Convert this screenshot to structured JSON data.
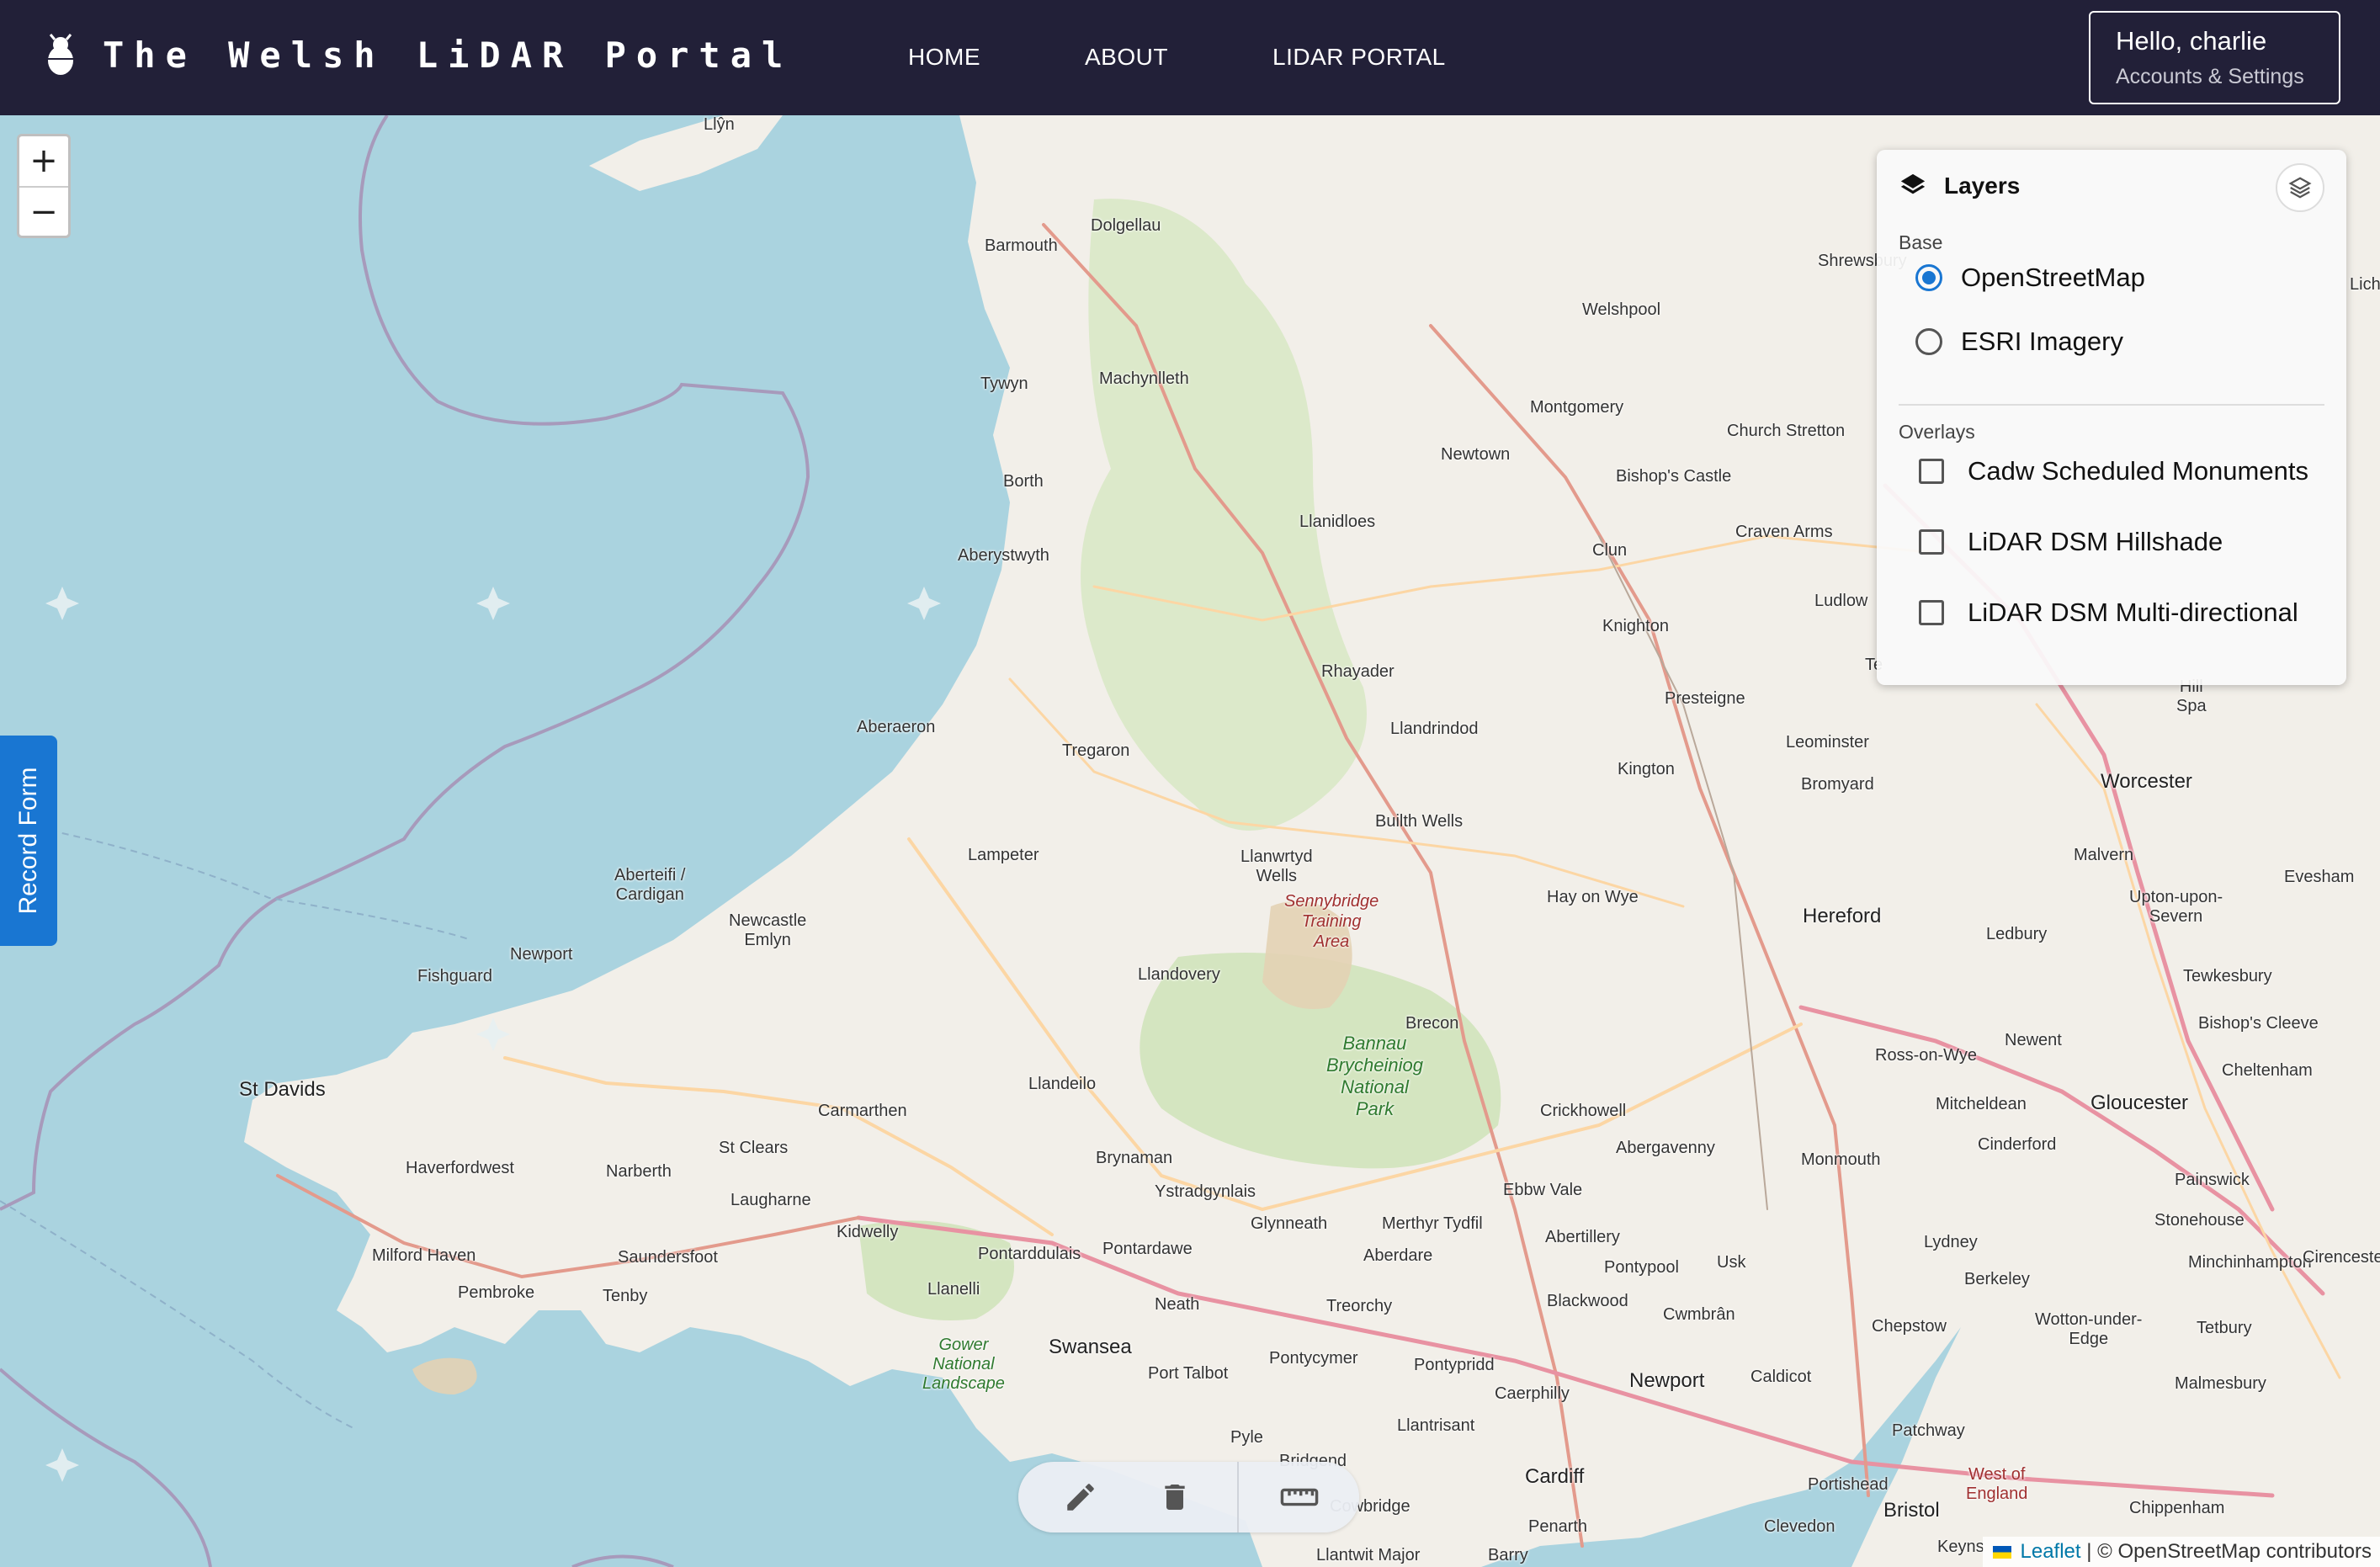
{
  "header": {
    "title": "The Welsh LiDAR Portal",
    "logo_icon": "bug-icon",
    "nav": [
      {
        "label": "HOME"
      },
      {
        "label": "ABOUT"
      },
      {
        "label": "LIDAR PORTAL"
      }
    ],
    "user": {
      "greeting": "Hello, charlie",
      "subtitle": "Accounts & Settings"
    }
  },
  "map": {
    "zoom_in": "+",
    "zoom_out": "−",
    "places": {
      "lyn": "Llŷn",
      "barmouth": "Barmouth",
      "dolgellau": "Dolgellau",
      "shrewsbury": "Shrewsbury",
      "welshpool": "Welshpool",
      "tywyn": "Tywyn",
      "machynlleth": "Machynlleth",
      "montgomery": "Montgomery",
      "church_stretton": "Church Stretton",
      "newtown": "Newtown",
      "bishops_castle": "Bishop's Castle",
      "borth": "Borth",
      "llanidloes": "Llanidloes",
      "craven_arms": "Craven Arms",
      "clun": "Clun",
      "aberystwyth": "Aberystwyth",
      "ludlow": "Ludlow",
      "knighton": "Knighton",
      "rhayader": "Rhayader",
      "presteigne": "Presteigne",
      "aberaeron": "Aberaeron",
      "llandrindod": "Llandrindod",
      "tregaron": "Tregaron",
      "leominster": "Leominster",
      "kington": "Kington",
      "builth_wells": "Builth Wells",
      "bromyard": "Bromyard",
      "worcester": "Worcester",
      "lampeter": "Lampeter",
      "llanwrtyd": "Llanwrtyd\nWells",
      "aberteifi": "Aberteifi /\nCardigan",
      "newcastle_emlyn": "Newcastle\nEmlyn",
      "hay_on_wye": "Hay on Wye",
      "hereford": "Hereford",
      "malvern": "Malvern",
      "evesham": "Evesham",
      "upton": "Upton-upon-\nSevern",
      "fishguard": "Fishguard",
      "newport_pemb": "Newport",
      "ledbury": "Ledbury",
      "llandovery": "Llandovery",
      "tewkesbury": "Tewkesbury",
      "brecon": "Brecon",
      "newent": "Newent",
      "bishops_cleeve": "Bishop's Cleeve",
      "ross_on_wye": "Ross-on-Wye",
      "st_davids": "St Davids",
      "llandeilo": "Llandeilo",
      "cheltenham": "Cheltenham",
      "carmarthen": "Carmarthen",
      "crickhowell": "Crickhowell",
      "mitcheldean": "Mitcheldean",
      "gloucester": "Gloucester",
      "haverfordwest": "Haverfordwest",
      "narberth": "Narberth",
      "st_clears": "St Clears",
      "brynaman": "Brynaman",
      "abergavenny": "Abergavenny",
      "cinderford": "Cinderford",
      "monmouth": "Monmouth",
      "painswick": "Painswick",
      "laugharne": "Laugharne",
      "ystradgynlais": "Ystradgynlais",
      "ebbw_vale": "Ebbw Vale",
      "milford_haven": "Milford Haven",
      "saundersfoot": "Saundersfoot",
      "kidwelly": "Kidwelly",
      "glynneath": "Glynneath",
      "merthyr": "Merthyr Tydfil",
      "abertillery": "Abertillery",
      "stonehouse": "Stonehouse",
      "pontardulais": "Pontarddulais",
      "pontardawe": "Pontardawe",
      "aberdare": "Aberdare",
      "pontypool": "Pontypool",
      "usk": "Usk",
      "lydney": "Lydney",
      "minchinhampton": "Minchinhampton",
      "pembroke": "Pembroke",
      "tenby": "Tenby",
      "llanelli": "Llanelli",
      "blackwood": "Blackwood",
      "berkeley": "Berkeley",
      "treorchy": "Treorchy",
      "cwmbran": "Cwmbrân",
      "neath": "Neath",
      "chepstow": "Chepstow",
      "wotton": "Wotton-under-\nEdge",
      "tetbury": "Tetbury",
      "swansea": "Swansea",
      "pontycymer": "Pontycymer",
      "port_talbot": "Port Talbot",
      "pontypridd": "Pontypridd",
      "caerphilly": "Caerphilly",
      "caldicot": "Caldicot",
      "newport": "Newport",
      "malmesbury": "Malmesbury",
      "llantrisant": "Llantrisant",
      "patchway": "Patchway",
      "pyle": "Pyle",
      "bridgend": "Bridgend",
      "cardiff": "Cardiff",
      "portishead": "Portishead",
      "cowbridge": "Cowbridge",
      "chippenham": "Chippenham",
      "bristol": "Bristol",
      "west_england": "West of\nEngland",
      "clevedon": "Clevedon",
      "penarth": "Penarth",
      "llantwit": "Llantwit Major",
      "barry": "Barry",
      "keynsham": "Keyns",
      "lich": "Lich",
      "te": "Te",
      "cirencester": "Cirencester",
      "spa": "Spa",
      "hillend": "Hill\nSpa"
    },
    "parks": {
      "bannau": "Bannau\nBrycheiniog\nNational\nPark",
      "gower": "Gower\nNational\nLandscape",
      "sennybridge": "Sennybridge\nTraining\nArea"
    }
  },
  "record_tab": {
    "label": "Record Form"
  },
  "layers": {
    "title": "Layers",
    "base_label": "Base",
    "base_options": [
      {
        "label": "OpenStreetMap",
        "selected": true
      },
      {
        "label": "ESRI Imagery",
        "selected": false
      }
    ],
    "overlays_label": "Overlays",
    "overlays": [
      {
        "label": "Cadw Scheduled Monuments",
        "checked": false
      },
      {
        "label": "LiDAR DSM Hillshade",
        "checked": false
      },
      {
        "label": "LiDAR DSM Multi-directional",
        "checked": false
      }
    ]
  },
  "toolbar": {
    "tools": [
      "pencil-icon",
      "trash-icon",
      "ruler-icon"
    ]
  },
  "attribution": {
    "link": "Leaflet",
    "separator": " | ",
    "text": "© OpenStreetMap contributors"
  },
  "colors": {
    "header_bg": "#222038",
    "accent": "#1976d2",
    "sea": "#aad3df",
    "land": "#f2efe9"
  }
}
